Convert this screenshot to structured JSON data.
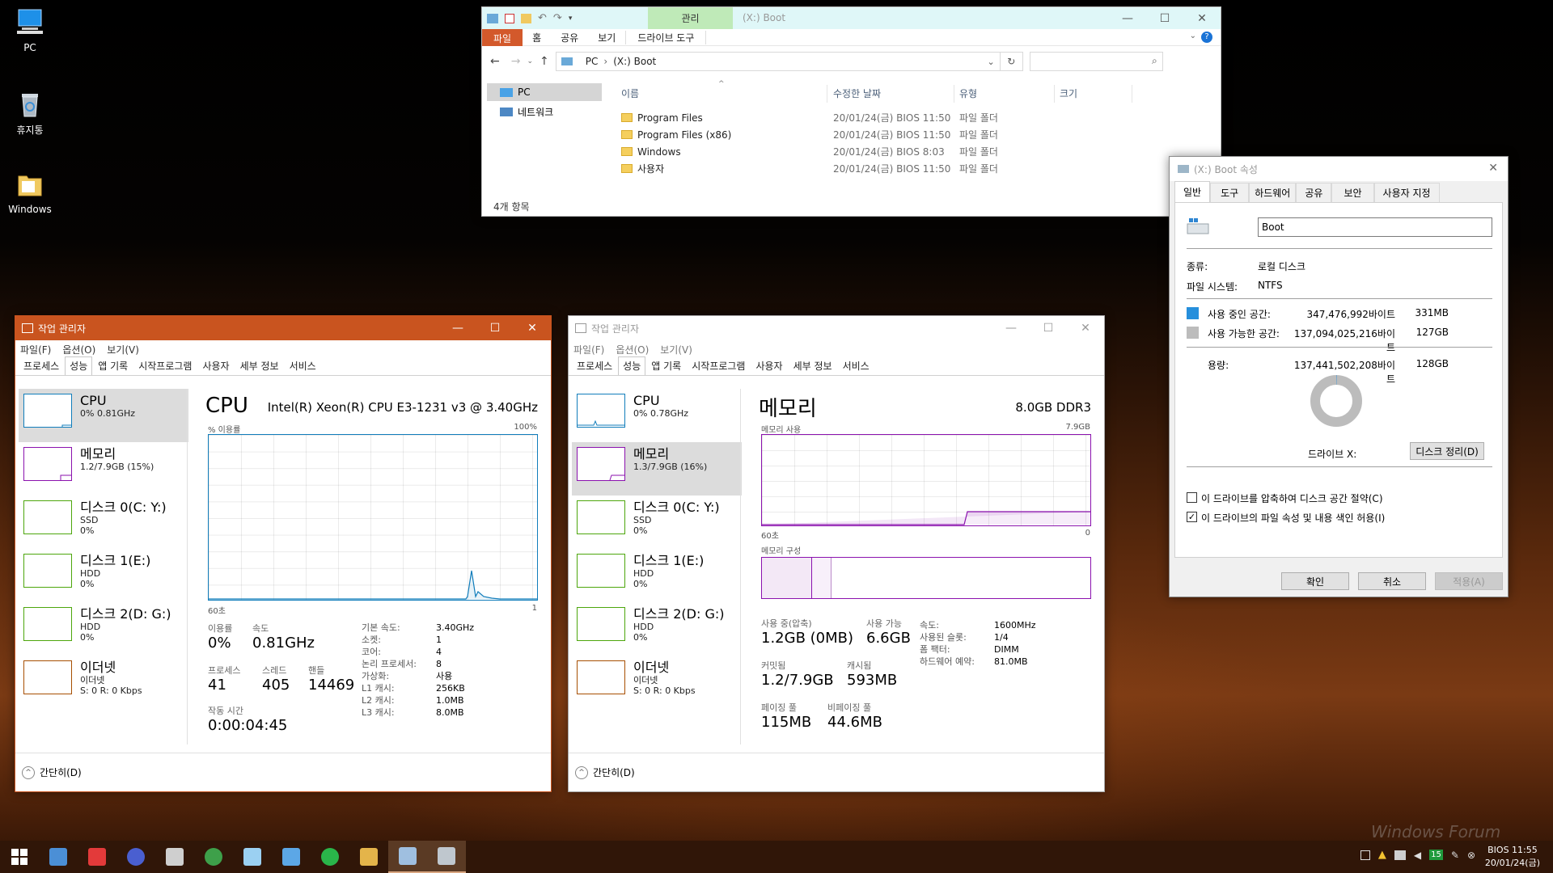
{
  "desktop": {
    "icons": [
      {
        "label": "PC"
      },
      {
        "label": "휴지통"
      },
      {
        "label": "Windows"
      }
    ],
    "watermark": "Windows Forum"
  },
  "explorer": {
    "title": "(X:) Boot",
    "ribbon_context": "관리",
    "ribbon_tabs": [
      "파일",
      "홈",
      "공유",
      "보기",
      "드라이브 도구"
    ],
    "path": [
      "PC",
      "(X:) Boot"
    ],
    "nav": [
      "PC",
      "네트워크"
    ],
    "columns": [
      "이름",
      "수정한 날짜",
      "유형",
      "크기"
    ],
    "rows": [
      {
        "name": "Program Files",
        "date": "20/01/24(금) BIOS  11:50",
        "type": "파일 폴더"
      },
      {
        "name": "Program Files (x86)",
        "date": "20/01/24(금) BIOS  11:50",
        "type": "파일 폴더"
      },
      {
        "name": "Windows",
        "date": "20/01/24(금) BIOS  8:03",
        "type": "파일 폴더"
      },
      {
        "name": "사용자",
        "date": "20/01/24(금) BIOS  11:50",
        "type": "파일 폴더"
      }
    ],
    "status": "4개 항목"
  },
  "properties": {
    "title": "(X:) Boot 속성",
    "tabs": [
      "일반",
      "도구",
      "하드웨어",
      "공유",
      "보안",
      "사용자 지정"
    ],
    "name_value": "Boot",
    "type_label": "종류:",
    "type_value": "로컬 디스크",
    "fs_label": "파일 시스템:",
    "fs_value": "NTFS",
    "used_label": "사용 중인 공간:",
    "used_bytes": "347,476,992바이트",
    "used_size": "331MB",
    "free_label": "사용 가능한 공간:",
    "free_bytes": "137,094,025,216바이트",
    "free_size": "127GB",
    "cap_label": "용량:",
    "cap_bytes": "137,441,502,208바이트",
    "cap_size": "128GB",
    "used_fraction": 0.0025,
    "drive_label": "드라이브 X:",
    "cleanup_button": "디스크 정리(D)",
    "compress_label": "이 드라이브를 압축하여 디스크 공간 절약(C)",
    "index_label": "이 드라이브의 파일 속성 및 내용 색인 허용(I)",
    "buttons": [
      "확인",
      "취소",
      "적용(A)"
    ]
  },
  "tm_common": {
    "menu": [
      "파일(F)",
      "옵션(O)",
      "보기(V)"
    ],
    "tabs": [
      "프로세스",
      "성능",
      "앱 기록",
      "시작프로그램",
      "사용자",
      "세부 정보",
      "서비스"
    ],
    "title": "작업 관리자",
    "fewer": "간단히(D)"
  },
  "tm1": {
    "side": [
      {
        "t1": "CPU",
        "t2": "0% 0.81GHz",
        "t3": ""
      },
      {
        "t1": "메모리",
        "t2": "1.2/7.9GB (15%)",
        "t3": ""
      },
      {
        "t1": "디스크 0(C: Y:)",
        "t2": "SSD",
        "t3": "0%"
      },
      {
        "t1": "디스크 1(E:)",
        "t2": "HDD",
        "t3": "0%"
      },
      {
        "t1": "디스크 2(D: G:)",
        "t2": "HDD",
        "t3": "0%"
      },
      {
        "t1": "이더넷",
        "t2": "이더넷",
        "t3": "S: 0 R: 0 Kbps"
      }
    ],
    "heading": "CPU",
    "model": "Intel(R) Xeon(R) CPU E3-1231 v3 @ 3.40GHz",
    "graph_label": "% 이용률",
    "graph_max": "100%",
    "graph_xl": "60초",
    "graph_xr": "1",
    "util_lbl": "이용률",
    "util_val": "0%",
    "speed_lbl": "속도",
    "speed_val": "0.81GHz",
    "proc_lbl": "프로세스",
    "proc_val": "41",
    "thread_lbl": "스레드",
    "thread_val": "405",
    "handle_lbl": "핸들",
    "handle_val": "14469",
    "uptime_lbl": "작동 시간",
    "uptime_val": "0:00:04:45",
    "info": [
      {
        "k": "기본 속도:",
        "v": "3.40GHz"
      },
      {
        "k": "소켓:",
        "v": "1"
      },
      {
        "k": "코어:",
        "v": "4"
      },
      {
        "k": "논리 프로세서:",
        "v": "8"
      },
      {
        "k": "가상화:",
        "v": "사용"
      },
      {
        "k": "L1 캐시:",
        "v": "256KB"
      },
      {
        "k": "L2 캐시:",
        "v": "1.0MB"
      },
      {
        "k": "L3 캐시:",
        "v": "8.0MB"
      }
    ]
  },
  "tm2": {
    "side": [
      {
        "t1": "CPU",
        "t2": "0% 0.78GHz",
        "t3": ""
      },
      {
        "t1": "메모리",
        "t2": "1.3/7.9GB (16%)",
        "t3": ""
      },
      {
        "t1": "디스크 0(C: Y:)",
        "t2": "SSD",
        "t3": "0%"
      },
      {
        "t1": "디스크 1(E:)",
        "t2": "HDD",
        "t3": "0%"
      },
      {
        "t1": "디스크 2(D: G:)",
        "t2": "HDD",
        "t3": "0%"
      },
      {
        "t1": "이더넷",
        "t2": "이더넷",
        "t3": "S: 0 R: 0 Kbps"
      }
    ],
    "heading": "메모리",
    "model": "8.0GB DDR3",
    "graph_label": "메모리 사용",
    "graph_max": "7.9GB",
    "graph_xl": "60초",
    "graph_xr": "0",
    "comp_label": "메모리 구성",
    "inuse_lbl": "사용 중(압축)",
    "inuse_val": "1.2GB (0MB)",
    "avail_lbl": "사용 가능",
    "avail_val": "6.6GB",
    "commit_lbl": "커밋됨",
    "commit_val": "1.2/7.9GB",
    "cache_lbl": "캐시됨",
    "cache_val": "593MB",
    "paged_lbl": "페이징 풀",
    "paged_val": "115MB",
    "nonpaged_lbl": "비페이징 풀",
    "nonpaged_val": "44.6MB",
    "info": [
      {
        "k": "속도:",
        "v": "1600MHz"
      },
      {
        "k": "사용된 슬롯:",
        "v": "1/4"
      },
      {
        "k": "폼 팩터:",
        "v": "DIMM"
      },
      {
        "k": "하드웨어 예약:",
        "v": "81.0MB"
      }
    ]
  },
  "taskbar": {
    "clock_line1": "BIOS  11:55",
    "clock_line2": "20/01/24(금)",
    "tray_badge": "15"
  },
  "colors": {
    "tm1_title": "#c9541f",
    "cpu_line": "#117dbb",
    "mem_line": "#8b12ae",
    "disk_line": "#4da60c",
    "net_line": "#a74f01",
    "ribbon_file": "#d3592b"
  }
}
